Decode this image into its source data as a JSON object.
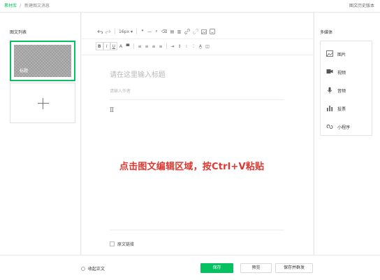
{
  "breadcrumb": {
    "root": "素材库",
    "separator": "/",
    "current": "新建图文消息"
  },
  "header": {
    "history_link": "图文历史版本"
  },
  "left_panel": {
    "title": "图文列表",
    "articles": [
      {
        "thumb_label": "标题",
        "selected": true
      }
    ]
  },
  "toolbar": {
    "row1": {
      "undo_icon": "undo-icon",
      "redo_icon": "redo-icon",
      "font_size": "16px",
      "font_size_arrow": "▾",
      "quote": "❞",
      "divider": "—",
      "format_brush": "⌕",
      "clear_format": "⌫",
      "table_icon": "▤",
      "columns_icon": "▥",
      "link_icon": "link-icon",
      "unlink_icon": "unlink-icon",
      "image_icon": "image-icon",
      "emoji_icon": "emoji-icon"
    },
    "row2": {
      "bold": "B",
      "italic": "I",
      "underline": "U",
      "font_color": "A",
      "bg_color": "▀",
      "align_left": "≡",
      "align_center": "≡",
      "align_right": "≡",
      "justify": "≡",
      "indent": "⇥",
      "line_height": "↕",
      "ordered_list": "⁝",
      "unordered_list": "⁚",
      "spacing": "A̲",
      "more": "◫"
    }
  },
  "editor": {
    "title_placeholder": "请在这里输入标题",
    "author_placeholder": "请输入作者",
    "cursor_glyph": "Ⅱ",
    "paste_hint": "点击图文编辑区域，按Ctrl+V粘贴",
    "original_link_label": "原文链接"
  },
  "right_panel": {
    "title": "多媒体",
    "items": [
      {
        "label": "图片",
        "icon": "image-icon"
      },
      {
        "label": "视频",
        "icon": "video-icon"
      },
      {
        "label": "音频",
        "icon": "audio-icon"
      },
      {
        "label": "投票",
        "icon": "vote-icon"
      },
      {
        "label": "小程序",
        "icon": "miniprogram-icon"
      }
    ]
  },
  "footer": {
    "collapse_label": "收起正文",
    "save": "保存",
    "preview": "预览",
    "save_and_mass": "保存并群发"
  },
  "colors": {
    "accent": "#07c160",
    "hint": "#e0362f"
  }
}
